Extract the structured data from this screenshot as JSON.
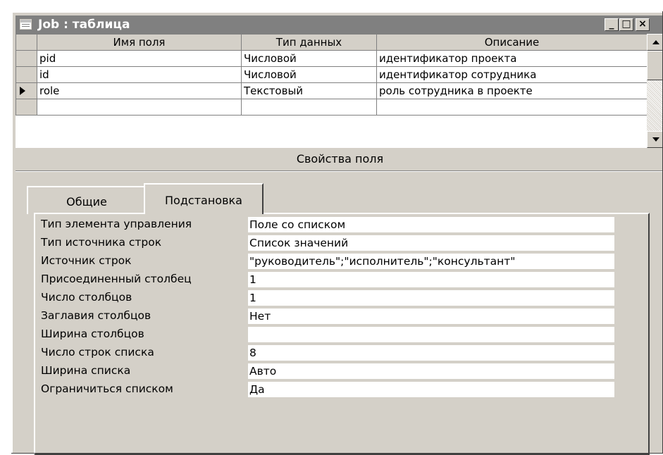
{
  "window": {
    "title": "Job : таблица",
    "icon": "table-icon"
  },
  "caption_buttons": {
    "minimize": "_",
    "maximize": "□",
    "close": "×"
  },
  "grid": {
    "columns": [
      "Имя поля",
      "Тип данных",
      "Описание"
    ],
    "rows": [
      [
        "pid",
        "Числовой",
        "идентификатор проекта"
      ],
      [
        "id",
        "Числовой",
        "идентификатор сотрудника"
      ],
      [
        "role",
        "Текстовый",
        "роль сотрудника в проекте"
      ],
      [
        "",
        "",
        ""
      ]
    ],
    "current_row": 2
  },
  "field_properties": {
    "caption": "Свойства поля",
    "tabs": [
      "Общие",
      "Подстановка"
    ],
    "active_tab": 1,
    "properties": [
      {
        "label": "Тип элемента управления",
        "value": "Поле со списком"
      },
      {
        "label": "Тип источника строк",
        "value": "Список значений"
      },
      {
        "label": "Источник строк",
        "value": "\"руководитель\";\"исполнитель\";\"консультант\""
      },
      {
        "label": "Присоединенный столбец",
        "value": "1"
      },
      {
        "label": "Число столбцов",
        "value": "1"
      },
      {
        "label": "Заглавия столбцов",
        "value": "Нет"
      },
      {
        "label": "Ширина столбцов",
        "value": ""
      },
      {
        "label": "Число строк списка",
        "value": "8"
      },
      {
        "label": "Ширина списка",
        "value": "Авто"
      },
      {
        "label": "Ограничиться списком",
        "value": "Да"
      }
    ]
  },
  "colors": {
    "face": "#d4d0c8",
    "titlebar": "#808080",
    "field": "#ffffff"
  }
}
